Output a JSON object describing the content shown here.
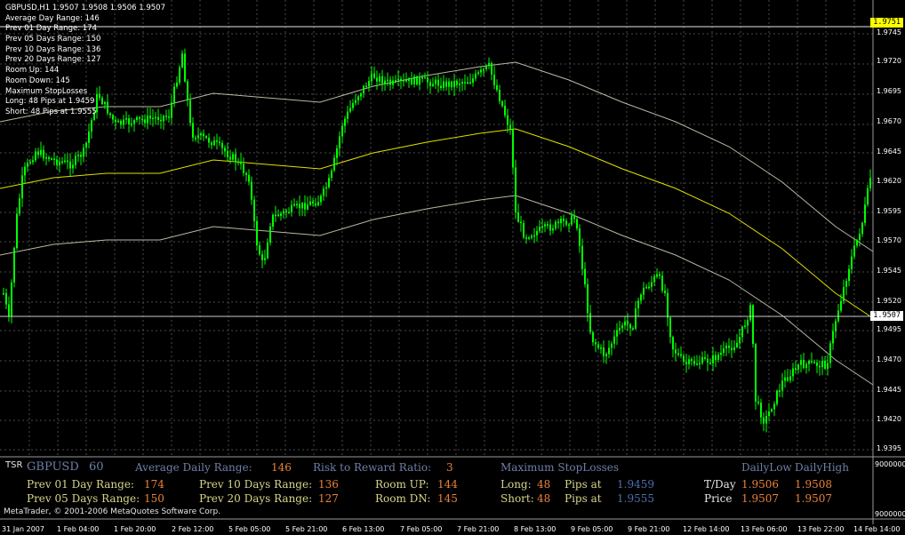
{
  "chart_info": {
    "symbol_line": "GBPUSD,H1  1.9507 1.9508 1.9506 1.9507",
    "lines": [
      "Average Day  Range: 146",
      "Prev 01  Day  Range: 174",
      "Prev 05  Days Range: 150",
      "Prev 10  Days Range: 136",
      "Prev 20  Days Range: 127",
      "Room Up:     144",
      "Room Down: 145",
      "Maximum StopLosses",
      "Long:  48 Pips at 1.9459",
      "Short: 48 Pips at 1.9555"
    ]
  },
  "price_axis": {
    "labels": [
      "1.9751",
      "1.9745",
      "1.9720",
      "1.9695",
      "1.9670",
      "1.9645",
      "1.9620",
      "1.9595",
      "1.9570",
      "1.9545",
      "1.9520",
      "1.9507",
      "1.9495",
      "1.9470",
      "1.9445",
      "1.9420",
      "1.9395"
    ],
    "highlight_top": "1.9751",
    "current_price": "1.9507"
  },
  "indicator_axis": {
    "labels": [
      "9000000",
      "9000000"
    ]
  },
  "time_axis": {
    "labels": [
      "31 Jan 2007",
      "1 Feb 04:00",
      "1 Feb 20:00",
      "2 Feb 12:00",
      "5 Feb 05:00",
      "5 Feb 21:00",
      "6 Feb 13:00",
      "7 Feb 05:00",
      "7 Feb 21:00",
      "8 Feb 13:00",
      "9 Feb 05:00",
      "9 Feb 21:00",
      "12 Feb 14:00",
      "13 Feb 06:00",
      "13 Feb 22:00",
      "14 Feb 14:00"
    ]
  },
  "tsr_panel": {
    "tag": "TSR",
    "symbol": "GBPUSD",
    "period": "60",
    "avg_daily_range_label": "Average Daily Range:",
    "avg_daily_range_value": "146",
    "risk_reward_label": "Risk to Reward Ratio:",
    "risk_reward_value": "3",
    "max_sl_label": "Maximum StopLosses",
    "daily_low_label": "DailyLow",
    "daily_high_label": "DailyHigh",
    "prev01_label": "Prev 01 Day Range:",
    "prev01_value": "174",
    "prev05_label": "Prev 05 Days Range:",
    "prev05_value": "150",
    "prev10_label": "Prev 10 Days Range:",
    "prev10_value": "136",
    "prev20_label": "Prev 20 Days Range:",
    "prev20_value": "127",
    "room_up_label": "Room UP:",
    "room_up_value": "144",
    "room_dn_label": "Room DN:",
    "room_dn_value": "145",
    "long_label": "Long:",
    "long_value": "48",
    "short_label": "Short:",
    "short_value": "48",
    "pips_at_label": "Pips at",
    "long_price": "1.9459",
    "short_price": "1.9555",
    "tday_label": "T/Day",
    "tday_low": "1.9506",
    "tday_high": "1.9508",
    "price_label": "Price",
    "price_low": "1.9507",
    "price_high": "1.9507",
    "copyright": "MetaTrader, © 2001-2006 MetaQuotes Software Corp."
  },
  "colors": {
    "candle": "#00ff00",
    "grid": "#4a4a4a",
    "ma_line": "#e0e000",
    "band_line": "#d8d8c0",
    "current_line": "#c8c8c8",
    "highlight_label_bg": "#ffff00"
  }
}
